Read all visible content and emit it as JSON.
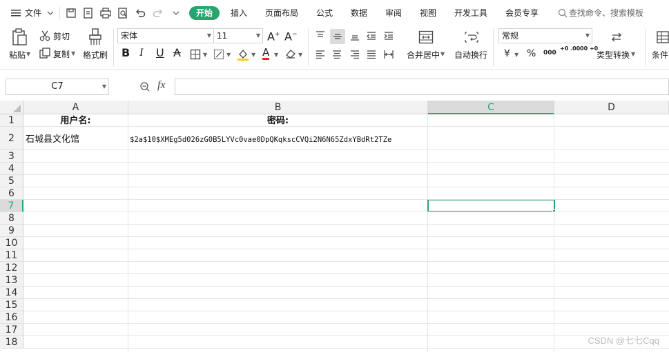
{
  "menubar": {
    "file_label": "文件",
    "tabs": [
      "开始",
      "插入",
      "页面布局",
      "公式",
      "数据",
      "审阅",
      "视图",
      "开发工具",
      "会员专享"
    ],
    "search_placeholder": "查找命令、搜索模板"
  },
  "ribbon": {
    "paste_label": "粘贴",
    "cut_label": "剪切",
    "copy_label": "复制",
    "format_painter_label": "格式刷",
    "font_name": "宋体",
    "font_size": "11",
    "bold_label": "B",
    "italic_label": "I",
    "underline_label": "U",
    "strike_label": "A",
    "font_color_label": "A",
    "merge_center_label": "合并居中",
    "wrap_text_label": "自动换行",
    "number_format": "常规",
    "currency_label": "¥",
    "percent_label": "%",
    "thousands_label": "000",
    "inc_decimal_label": "+0 .00",
    "dec_decimal_label": ".00 +0",
    "type_convert_label": "类型转换",
    "conditional_label": "条件"
  },
  "formula_bar": {
    "name_box": "C7",
    "fx_label": "fx",
    "formula_value": ""
  },
  "sheet": {
    "columns": [
      "A",
      "B",
      "C",
      "D"
    ],
    "selected_column": "C",
    "rows": [
      "1",
      "2",
      "3",
      "4",
      "5",
      "6",
      "7",
      "8",
      "9",
      "10",
      "11",
      "12",
      "13",
      "14",
      "15",
      "16",
      "17",
      "18"
    ],
    "selected_row": "7",
    "cells": {
      "A1": "用户名:",
      "B1": "密码:",
      "A2": "石城县文化馆",
      "B2": "$2a$10$XMEg5d026zG0B5LYVc0vae0DpQKqkscCVQi2N6N65ZdxYBdRt2TZe"
    },
    "active_cell": "C7"
  },
  "watermark": "CSDN @七七Cqq",
  "colors": {
    "accent": "#27a56f",
    "font_color_underline": "#e0251b",
    "highlight": "#f5d000"
  }
}
